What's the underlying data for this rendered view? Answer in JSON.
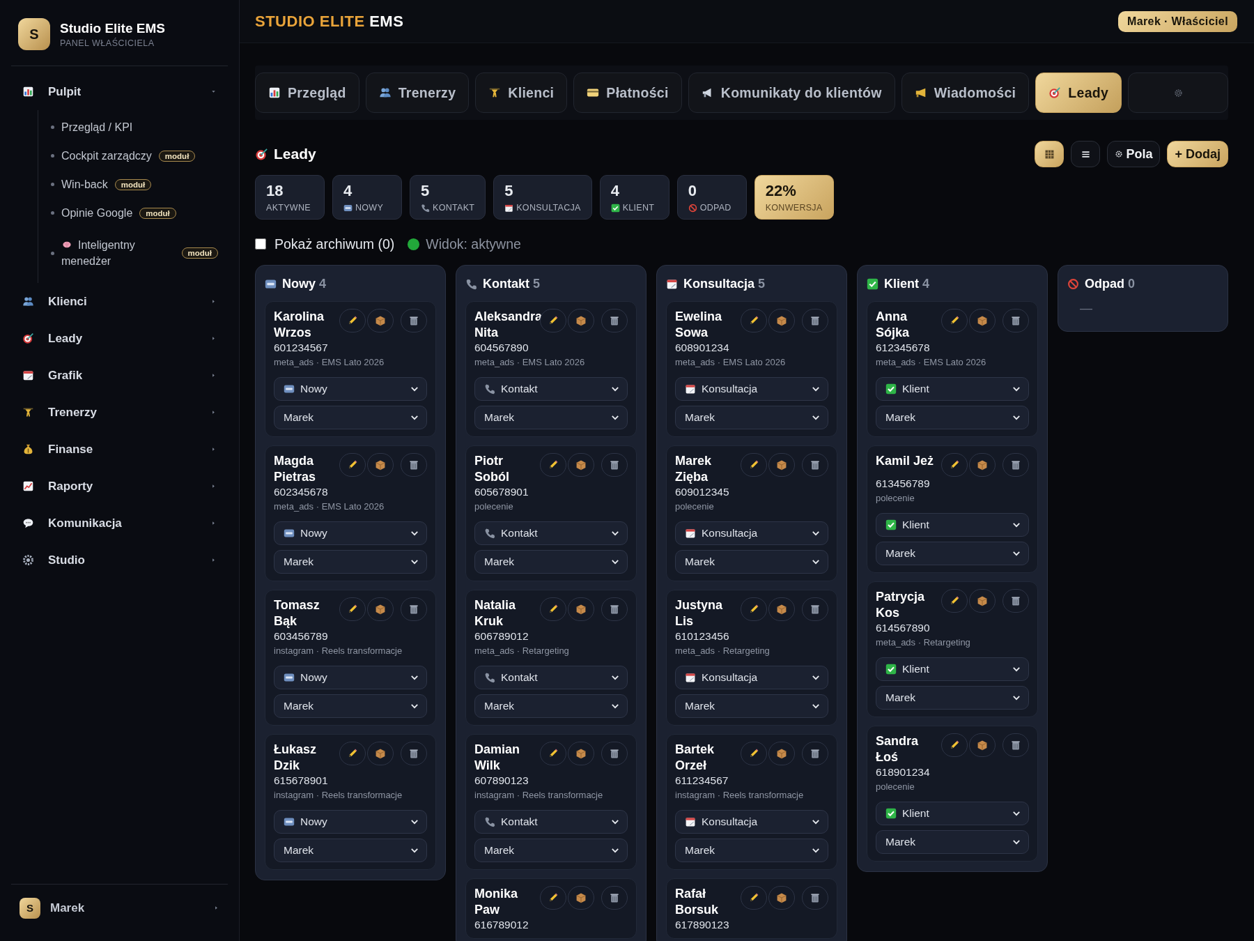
{
  "sidebar": {
    "brand": {
      "logo": "S",
      "title": "Studio Elite EMS",
      "subtitle": "PANEL WŁAŚCICIELA"
    },
    "nav": [
      {
        "label": "Pulpit",
        "expanded": true,
        "children": [
          {
            "kind": "link",
            "label": "Przegląd / KPI"
          },
          {
            "kind": "link",
            "label": "Cockpit zarządczy",
            "badge": "moduł"
          },
          {
            "kind": "link",
            "label": "Win-back",
            "badge": "moduł"
          },
          {
            "kind": "link",
            "label": "Opinie Google",
            "badge": "moduł"
          },
          {
            "kind": "ai",
            "label": "Inteligentny menedżer",
            "badge": "moduł"
          }
        ]
      },
      {
        "label": "Klienci",
        "expanded": false
      },
      {
        "label": "Leady",
        "expanded": false
      },
      {
        "label": "Grafik",
        "expanded": false
      },
      {
        "label": "Trenerzy",
        "expanded": false
      },
      {
        "label": "Finanse",
        "expanded": false
      },
      {
        "label": "Raporty",
        "expanded": false
      },
      {
        "label": "Komunikacja",
        "expanded": false
      },
      {
        "label": "Studio",
        "expanded": false
      }
    ],
    "user": {
      "avatar": "S",
      "name": "Marek"
    }
  },
  "header": {
    "title_accent": "STUDIO ELITE",
    "title_rest": "EMS",
    "user_badge": "Marek · Właściciel"
  },
  "tabs": [
    {
      "label": "Przegląd",
      "selected": false
    },
    {
      "label": "Trenerzy",
      "selected": false
    },
    {
      "label": "Klienci",
      "selected": false
    },
    {
      "label": "Płatności",
      "selected": false
    },
    {
      "label": "Komunikaty do klientów",
      "selected": false
    },
    {
      "label": "Wiadomości",
      "selected": false
    },
    {
      "label": "Leady",
      "selected": true
    },
    {
      "selected": false
    }
  ],
  "section": {
    "title": "Leady",
    "views": [
      {
        "kind": "grid",
        "selected": true
      },
      {
        "kind": "list",
        "selected": false
      }
    ],
    "fields_button": "Pola",
    "add_button": "+ Dodaj"
  },
  "stats": [
    {
      "kind": "total",
      "value": "18",
      "label": "AKTYWNE"
    },
    {
      "kind": "nowy",
      "value": "4",
      "label": "NOWY"
    },
    {
      "kind": "kontakt",
      "value": "5",
      "label": "KONTAKT"
    },
    {
      "kind": "konsultacja",
      "value": "5",
      "label": "KONSULTACJA"
    },
    {
      "kind": "klient",
      "value": "4",
      "label": "KLIENT"
    },
    {
      "kind": "odpad",
      "value": "0",
      "label": "ODPAD"
    },
    {
      "kind": "rate",
      "value": "22%",
      "label": "KONWERSJA"
    }
  ],
  "filters": {
    "archive": {
      "label": "Pokaż archiwum (0)",
      "checked": false
    },
    "view_label": "Widok: aktywne"
  },
  "columns": [
    {
      "kind": "nowy",
      "title": "Nowy",
      "count": "4",
      "leads": [
        {
          "name": "Karolina Wrzos",
          "phone": "601234567",
          "source": "meta_ads · EMS Lato 2026",
          "status": "Nowy",
          "owner": "Marek"
        },
        {
          "name": "Magda Pietras",
          "phone": "602345678",
          "source": "meta_ads · EMS Lato 2026",
          "status": "Nowy",
          "owner": "Marek"
        },
        {
          "name": "Tomasz Bąk",
          "phone": "603456789",
          "source": "instagram · Reels transformacje",
          "status": "Nowy",
          "owner": "Marek"
        },
        {
          "name": "Łukasz Dzik",
          "phone": "615678901",
          "source": "instagram · Reels transformacje",
          "status": "Nowy",
          "owner": "Marek"
        }
      ]
    },
    {
      "kind": "kontakt",
      "title": "Kontakt",
      "count": "5",
      "leads": [
        {
          "name": "Aleksandra Nita",
          "phone": "604567890",
          "source": "meta_ads · EMS Lato 2026",
          "status": "Kontakt",
          "owner": "Marek"
        },
        {
          "name": "Piotr Soból",
          "phone": "605678901",
          "source": "polecenie",
          "status": "Kontakt",
          "owner": "Marek"
        },
        {
          "name": "Natalia Kruk",
          "phone": "606789012",
          "source": "meta_ads · Retargeting",
          "status": "Kontakt",
          "owner": "Marek"
        },
        {
          "name": "Damian Wilk",
          "phone": "607890123",
          "source": "instagram · Reels transformacje",
          "status": "Kontakt",
          "owner": "Marek"
        },
        {
          "name": "Monika Paw",
          "phone": "616789012"
        }
      ]
    },
    {
      "kind": "konsultacja",
      "title": "Konsultacja",
      "count": "5",
      "leads": [
        {
          "name": "Ewelina Sowa",
          "phone": "608901234",
          "source": "meta_ads · EMS Lato 2026",
          "status": "Konsultacja",
          "owner": "Marek"
        },
        {
          "name": "Marek Zięba",
          "phone": "609012345",
          "source": "polecenie",
          "status": "Konsultacja",
          "owner": "Marek"
        },
        {
          "name": "Justyna Lis",
          "phone": "610123456",
          "source": "meta_ads · Retargeting",
          "status": "Konsultacja",
          "owner": "Marek"
        },
        {
          "name": "Bartek Orzeł",
          "phone": "611234567",
          "source": "instagram · Reels transformacje",
          "status": "Konsultacja",
          "owner": "Marek"
        },
        {
          "name": "Rafał Borsuk",
          "phone": "617890123"
        }
      ]
    },
    {
      "kind": "klient",
      "title": "Klient",
      "count": "4",
      "leads": [
        {
          "name": "Anna Sójka",
          "phone": "612345678",
          "source": "meta_ads · EMS Lato 2026",
          "status": "Klient",
          "owner": "Marek"
        },
        {
          "name": "Kamil Jeż",
          "phone": "613456789",
          "source": "polecenie",
          "status": "Klient",
          "owner": "Marek"
        },
        {
          "name": "Patrycja Kos",
          "phone": "614567890",
          "source": "meta_ads · Retargeting",
          "status": "Klient",
          "owner": "Marek"
        },
        {
          "name": "Sandra Łoś",
          "phone": "618901234",
          "source": "polecenie",
          "status": "Klient",
          "owner": "Marek"
        }
      ]
    },
    {
      "kind": "odpad",
      "title": "Odpad",
      "count": "0",
      "empty_text": "—"
    }
  ]
}
